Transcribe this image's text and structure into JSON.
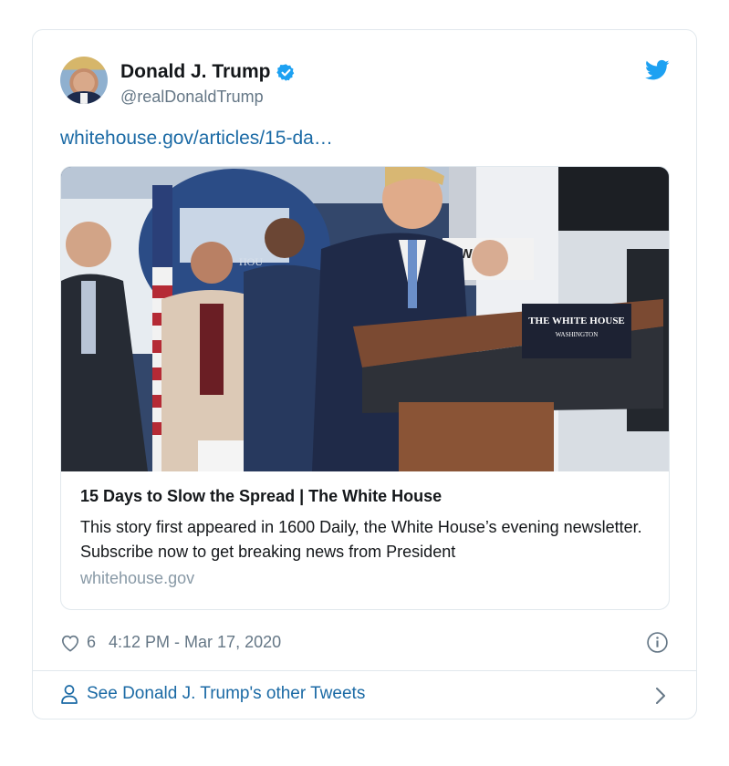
{
  "tweet": {
    "author": {
      "display_name": "Donald J. Trump",
      "handle": "@realDonaldTrump",
      "verified": true
    },
    "link_text": "whitehouse.gov/articles/15-da…",
    "card": {
      "title": "15 Days to Slow the Spread | The White House",
      "description": "This story first appeared in 1600 Daily, the White House’s evening newsletter. Subscribe now to get breaking news from President",
      "domain": "whitehouse.gov",
      "image": {
        "podium_sign_line1": "THE WHITE HOUSE",
        "podium_sign_line2": "WASHINGTON",
        "backdrop_text": "HOU",
        "banner_text": "OW"
      }
    },
    "likes": "6",
    "timestamp": "4:12 PM - Mar 17, 2020",
    "other_tweets_label": "See Donald J. Trump's other Tweets"
  },
  "icons": {
    "verified": "verified-badge-icon",
    "brand": "twitter-bird-icon",
    "like": "heart-icon",
    "info": "info-icon",
    "profile": "person-icon",
    "more": "chevron-right-icon"
  },
  "colors": {
    "link": "#1b6aa5",
    "brand_blue": "#1da1f2",
    "muted": "#657786",
    "border": "#e1e8ed"
  }
}
